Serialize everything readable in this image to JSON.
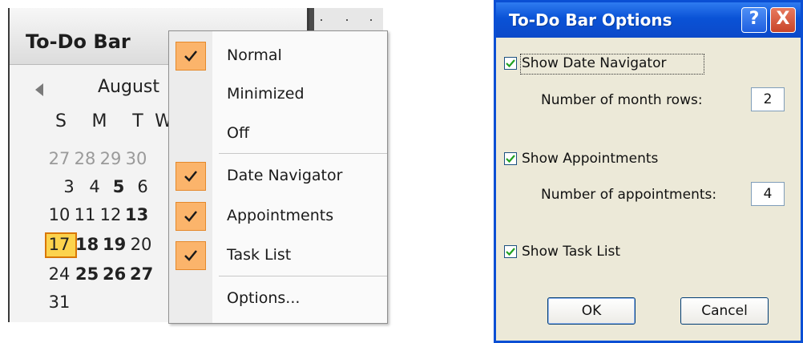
{
  "todo_bar": {
    "title": "To-Do Bar",
    "calendar": {
      "month": "August",
      "weekdays": [
        "S",
        "M",
        "T",
        "W"
      ],
      "rows": [
        [
          "27",
          "28",
          "29",
          "30"
        ],
        [
          "3",
          "4",
          "5",
          "6"
        ],
        [
          "10",
          "11",
          "12",
          "13"
        ],
        [
          "17",
          "18",
          "19",
          "20"
        ],
        [
          "24",
          "25",
          "26",
          "27"
        ],
        [
          "31"
        ]
      ],
      "today": "17"
    }
  },
  "context_menu": {
    "items": [
      {
        "label": "Normal",
        "checked": true
      },
      {
        "label": "Minimized",
        "checked": false
      },
      {
        "label": "Off",
        "checked": false
      },
      {
        "label": "Date Navigator",
        "checked": true
      },
      {
        "label": "Appointments",
        "checked": true
      },
      {
        "label": "Task List",
        "checked": true
      },
      {
        "label": "Options...",
        "checked": false
      }
    ]
  },
  "dialog": {
    "title": "To-Do Bar Options",
    "help_glyph": "?",
    "close_glyph": "X",
    "show_date_navigator": {
      "label": "Show Date Navigator",
      "checked": true
    },
    "month_rows": {
      "label": "Number of month rows:",
      "value": "2"
    },
    "show_appointments": {
      "label": "Show Appointments",
      "checked": true
    },
    "appointments": {
      "label": "Number of appointments:",
      "value": "4"
    },
    "show_task_list": {
      "label": "Show Task List",
      "checked": true
    },
    "ok_label": "OK",
    "cancel_label": "Cancel"
  },
  "colors": {
    "menu_check_bg": "#fbb46b",
    "today_highlight": "#fcd34d",
    "dialog_title_bar": "#0a52d6",
    "dialog_face": "#ece9d8"
  }
}
